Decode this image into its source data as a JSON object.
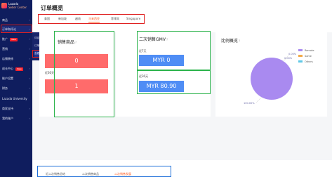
{
  "sidebar": {
    "logo_line1": "Lazada",
    "logo_line2": "Seller Center",
    "items": [
      {
        "label": "商品",
        "new": false
      },
      {
        "label": "订单和评论",
        "new": false
      },
      {
        "label": "推广",
        "new": true
      },
      {
        "label": "营销",
        "new": false
      },
      {
        "label": "店铺装修",
        "new": false
      },
      {
        "label": "成长中心",
        "new": true
      },
      {
        "label": "账户设置",
        "new": false
      },
      {
        "label": "财务",
        "new": false
      },
      {
        "label": "Lazada University",
        "new": false
      },
      {
        "label": "商家支持",
        "new": false
      },
      {
        "label": "我的账户",
        "new": false
      }
    ],
    "new_badge": "New"
  },
  "submenu": {
    "items": [
      "订单",
      "评论",
      "订单工作台",
      "查看二次销售"
    ]
  },
  "header": {
    "title": "订单概览",
    "tabs": [
      "泰国",
      "新加坡",
      "越南",
      "马来西亚",
      "菲律宾",
      "Singapore"
    ]
  },
  "cards": {
    "sales": {
      "title": "销售商品",
      "label_7": "近7天",
      "value_7": "0",
      "label_30": "近30天",
      "value_30": "1"
    },
    "gmv": {
      "title": "二次销售GMV",
      "label_7": "近7天",
      "value_7": "MYR 0",
      "label_30": "近30天",
      "value_30": "MYR 80.90"
    },
    "ratio": {
      "title": "比例概览",
      "label_top1": "0.00%",
      "label_top2": "0.00%",
      "label_bottom": "100.00%"
    }
  },
  "chart_data": {
    "type": "pie",
    "series": [
      {
        "name": "Remote",
        "value": 100.0
      },
      {
        "name": "Same",
        "value": 0.0
      },
      {
        "name": "Others",
        "value": 0.0
      }
    ],
    "colors": [
      "#a98af0",
      "#f2a94a",
      "#5fc8e6"
    ],
    "legend_position": "top-right"
  },
  "bottom_tabs": [
    "近二次销售总结",
    "二次销售商品",
    "二次销售发展"
  ],
  "accent_color": "#ff5a1f"
}
